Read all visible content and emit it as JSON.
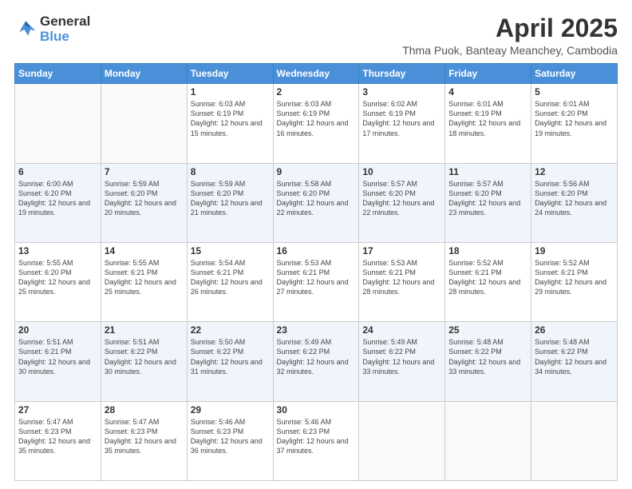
{
  "header": {
    "logo_line1": "General",
    "logo_line2": "Blue",
    "month_title": "April 2025",
    "location": "Thma Puok, Banteay Meanchey, Cambodia"
  },
  "days_of_week": [
    "Sunday",
    "Monday",
    "Tuesday",
    "Wednesday",
    "Thursday",
    "Friday",
    "Saturday"
  ],
  "weeks": [
    [
      {
        "day": "",
        "info": ""
      },
      {
        "day": "",
        "info": ""
      },
      {
        "day": "1",
        "info": "Sunrise: 6:03 AM\nSunset: 6:19 PM\nDaylight: 12 hours and 15 minutes."
      },
      {
        "day": "2",
        "info": "Sunrise: 6:03 AM\nSunset: 6:19 PM\nDaylight: 12 hours and 16 minutes."
      },
      {
        "day": "3",
        "info": "Sunrise: 6:02 AM\nSunset: 6:19 PM\nDaylight: 12 hours and 17 minutes."
      },
      {
        "day": "4",
        "info": "Sunrise: 6:01 AM\nSunset: 6:19 PM\nDaylight: 12 hours and 18 minutes."
      },
      {
        "day": "5",
        "info": "Sunrise: 6:01 AM\nSunset: 6:20 PM\nDaylight: 12 hours and 19 minutes."
      }
    ],
    [
      {
        "day": "6",
        "info": "Sunrise: 6:00 AM\nSunset: 6:20 PM\nDaylight: 12 hours and 19 minutes."
      },
      {
        "day": "7",
        "info": "Sunrise: 5:59 AM\nSunset: 6:20 PM\nDaylight: 12 hours and 20 minutes."
      },
      {
        "day": "8",
        "info": "Sunrise: 5:59 AM\nSunset: 6:20 PM\nDaylight: 12 hours and 21 minutes."
      },
      {
        "day": "9",
        "info": "Sunrise: 5:58 AM\nSunset: 6:20 PM\nDaylight: 12 hours and 22 minutes."
      },
      {
        "day": "10",
        "info": "Sunrise: 5:57 AM\nSunset: 6:20 PM\nDaylight: 12 hours and 22 minutes."
      },
      {
        "day": "11",
        "info": "Sunrise: 5:57 AM\nSunset: 6:20 PM\nDaylight: 12 hours and 23 minutes."
      },
      {
        "day": "12",
        "info": "Sunrise: 5:56 AM\nSunset: 6:20 PM\nDaylight: 12 hours and 24 minutes."
      }
    ],
    [
      {
        "day": "13",
        "info": "Sunrise: 5:55 AM\nSunset: 6:20 PM\nDaylight: 12 hours and 25 minutes."
      },
      {
        "day": "14",
        "info": "Sunrise: 5:55 AM\nSunset: 6:21 PM\nDaylight: 12 hours and 25 minutes."
      },
      {
        "day": "15",
        "info": "Sunrise: 5:54 AM\nSunset: 6:21 PM\nDaylight: 12 hours and 26 minutes."
      },
      {
        "day": "16",
        "info": "Sunrise: 5:53 AM\nSunset: 6:21 PM\nDaylight: 12 hours and 27 minutes."
      },
      {
        "day": "17",
        "info": "Sunrise: 5:53 AM\nSunset: 6:21 PM\nDaylight: 12 hours and 28 minutes."
      },
      {
        "day": "18",
        "info": "Sunrise: 5:52 AM\nSunset: 6:21 PM\nDaylight: 12 hours and 28 minutes."
      },
      {
        "day": "19",
        "info": "Sunrise: 5:52 AM\nSunset: 6:21 PM\nDaylight: 12 hours and 29 minutes."
      }
    ],
    [
      {
        "day": "20",
        "info": "Sunrise: 5:51 AM\nSunset: 6:21 PM\nDaylight: 12 hours and 30 minutes."
      },
      {
        "day": "21",
        "info": "Sunrise: 5:51 AM\nSunset: 6:22 PM\nDaylight: 12 hours and 30 minutes."
      },
      {
        "day": "22",
        "info": "Sunrise: 5:50 AM\nSunset: 6:22 PM\nDaylight: 12 hours and 31 minutes."
      },
      {
        "day": "23",
        "info": "Sunrise: 5:49 AM\nSunset: 6:22 PM\nDaylight: 12 hours and 32 minutes."
      },
      {
        "day": "24",
        "info": "Sunrise: 5:49 AM\nSunset: 6:22 PM\nDaylight: 12 hours and 33 minutes."
      },
      {
        "day": "25",
        "info": "Sunrise: 5:48 AM\nSunset: 6:22 PM\nDaylight: 12 hours and 33 minutes."
      },
      {
        "day": "26",
        "info": "Sunrise: 5:48 AM\nSunset: 6:22 PM\nDaylight: 12 hours and 34 minutes."
      }
    ],
    [
      {
        "day": "27",
        "info": "Sunrise: 5:47 AM\nSunset: 6:23 PM\nDaylight: 12 hours and 35 minutes."
      },
      {
        "day": "28",
        "info": "Sunrise: 5:47 AM\nSunset: 6:23 PM\nDaylight: 12 hours and 35 minutes."
      },
      {
        "day": "29",
        "info": "Sunrise: 5:46 AM\nSunset: 6:23 PM\nDaylight: 12 hours and 36 minutes."
      },
      {
        "day": "30",
        "info": "Sunrise: 5:46 AM\nSunset: 6:23 PM\nDaylight: 12 hours and 37 minutes."
      },
      {
        "day": "",
        "info": ""
      },
      {
        "day": "",
        "info": ""
      },
      {
        "day": "",
        "info": ""
      }
    ]
  ]
}
